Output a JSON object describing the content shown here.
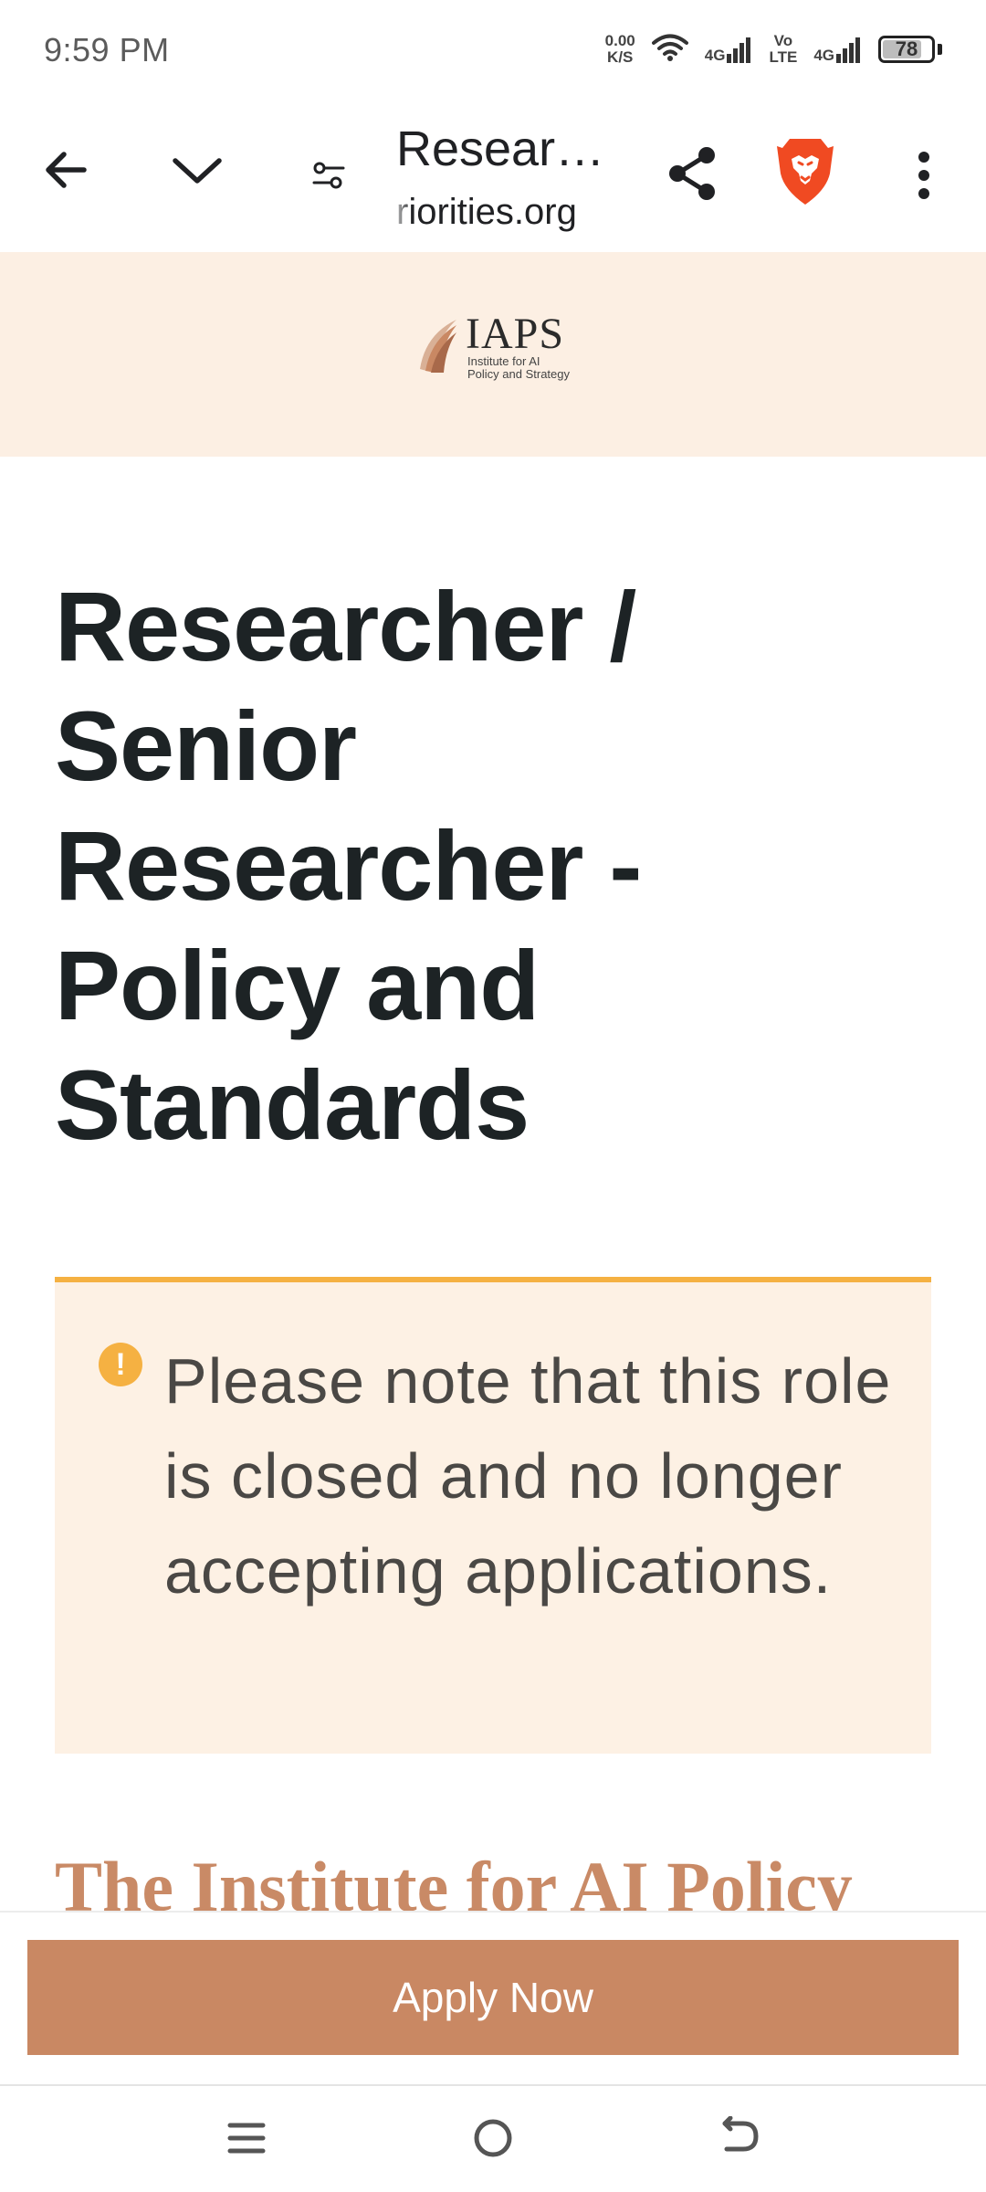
{
  "status_bar": {
    "time": "9:59 PM",
    "net_speed_value": "0.00",
    "net_speed_unit": "K/S",
    "sim1_label": "4G",
    "volte_top": "Vo",
    "volte_bottom": "LTE",
    "sim2_label": "4G",
    "battery_level": "78",
    "icons": [
      "wifi-icon",
      "signal-icon",
      "battery-icon"
    ]
  },
  "browser": {
    "page_title": "Resear…",
    "url": "riorities.org",
    "icons": [
      "back-arrow-icon",
      "chevron-down-icon",
      "page-settings-icon",
      "share-icon",
      "brave-lion-icon",
      "more-vert-icon"
    ]
  },
  "site": {
    "logo_name": "IAPS",
    "logo_tagline_line1": "Institute for AI",
    "logo_tagline_line2": "Policy and Strategy"
  },
  "job": {
    "title": "Researcher / Senior Researcher - Policy and Standards",
    "closed_notice": "Please note that this role is closed and no longer accepting applications.",
    "intro_heading": "The Institute for AI Policy"
  },
  "apply": {
    "label": "Apply Now"
  },
  "colors": {
    "header_band": "#fcefe3",
    "notice_bg": "#fdf1e4",
    "notice_accent": "#f5b142",
    "brand_copper": "#c98863",
    "title_text": "#1d2325"
  }
}
